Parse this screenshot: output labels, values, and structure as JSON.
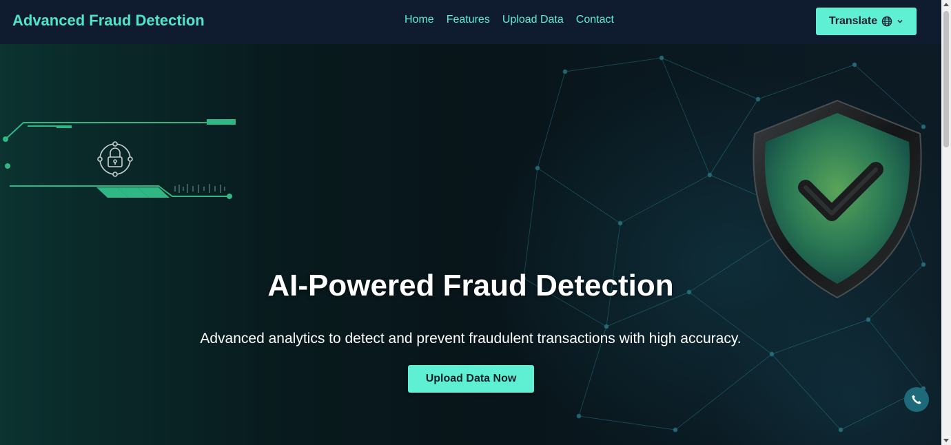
{
  "navbar": {
    "brand": "Advanced Fraud Detection",
    "links": [
      "Home",
      "Features",
      "Upload Data",
      "Contact"
    ],
    "translate_label": "Translate"
  },
  "hero": {
    "title": "AI-Powered Fraud Detection",
    "subtitle": "Advanced analytics to detect and prevent fraudulent transactions with high accuracy.",
    "cta_label": "Upload Data Now"
  },
  "icons": {
    "translate": "globe-icon",
    "dropdown": "chevron-down-icon",
    "contact": "phone-icon",
    "hero_graphic": "shield-check-icon",
    "circuit_graphic": "lock-icon"
  },
  "colors": {
    "accent": "#5ff0d4",
    "brand_text": "#4ee6c8",
    "navbar_bg": "#0f1b2e",
    "phone_button": "#1c6a7a"
  }
}
